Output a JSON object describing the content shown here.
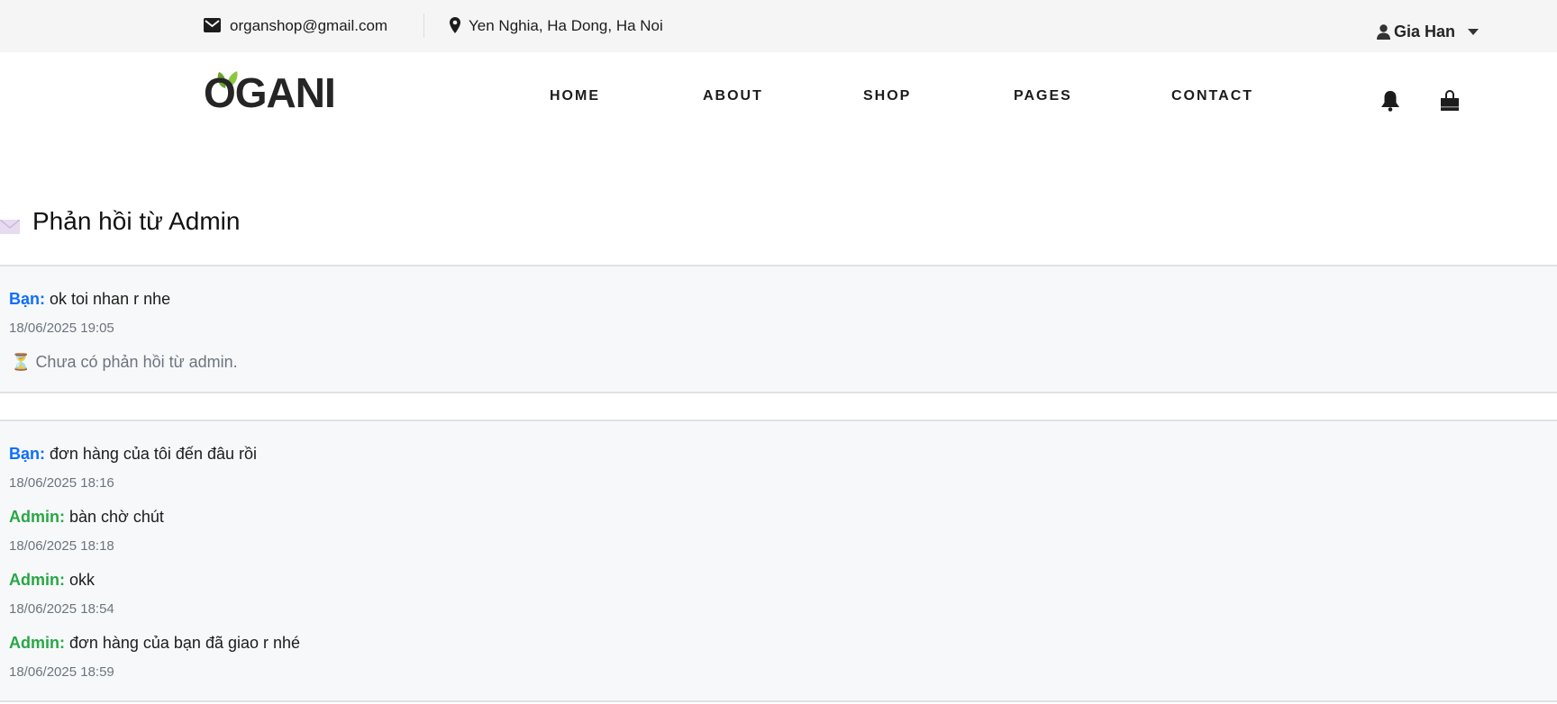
{
  "topbar": {
    "email": "organshop@gmail.com",
    "address": "Yen Nghia, Ha Dong, Ha Noi",
    "user": "Gia Han"
  },
  "header": {
    "logo": "OGANI",
    "nav": [
      "HOME",
      "ABOUT",
      "SHOP",
      "PAGES",
      "CONTACT"
    ]
  },
  "page": {
    "title": "Phản hồi từ Admin"
  },
  "threads": [
    {
      "messages": [
        {
          "sender": "Bạn:",
          "role": "user",
          "text": "ok toi nhan r nhe",
          "date": "18/06/2025 19:05"
        }
      ],
      "pending": "Chưa có phản hồi từ admin."
    },
    {
      "messages": [
        {
          "sender": "Bạn:",
          "role": "user",
          "text": "đơn hàng của tôi đến đâu rồi",
          "date": "18/06/2025 18:16"
        },
        {
          "sender": "Admin:",
          "role": "admin",
          "text": "bàn chờ chút",
          "date": "18/06/2025 18:18"
        },
        {
          "sender": "Admin:",
          "role": "admin",
          "text": "okk",
          "date": "18/06/2025 18:54"
        },
        {
          "sender": "Admin:",
          "role": "admin",
          "text": "đơn hàng của bạn đã giao r nhé",
          "date": "18/06/2025 18:59"
        }
      ]
    }
  ],
  "colors": {
    "user": "#0d6efd",
    "admin": "#28a745",
    "logo_leaf": "#7fad39"
  }
}
